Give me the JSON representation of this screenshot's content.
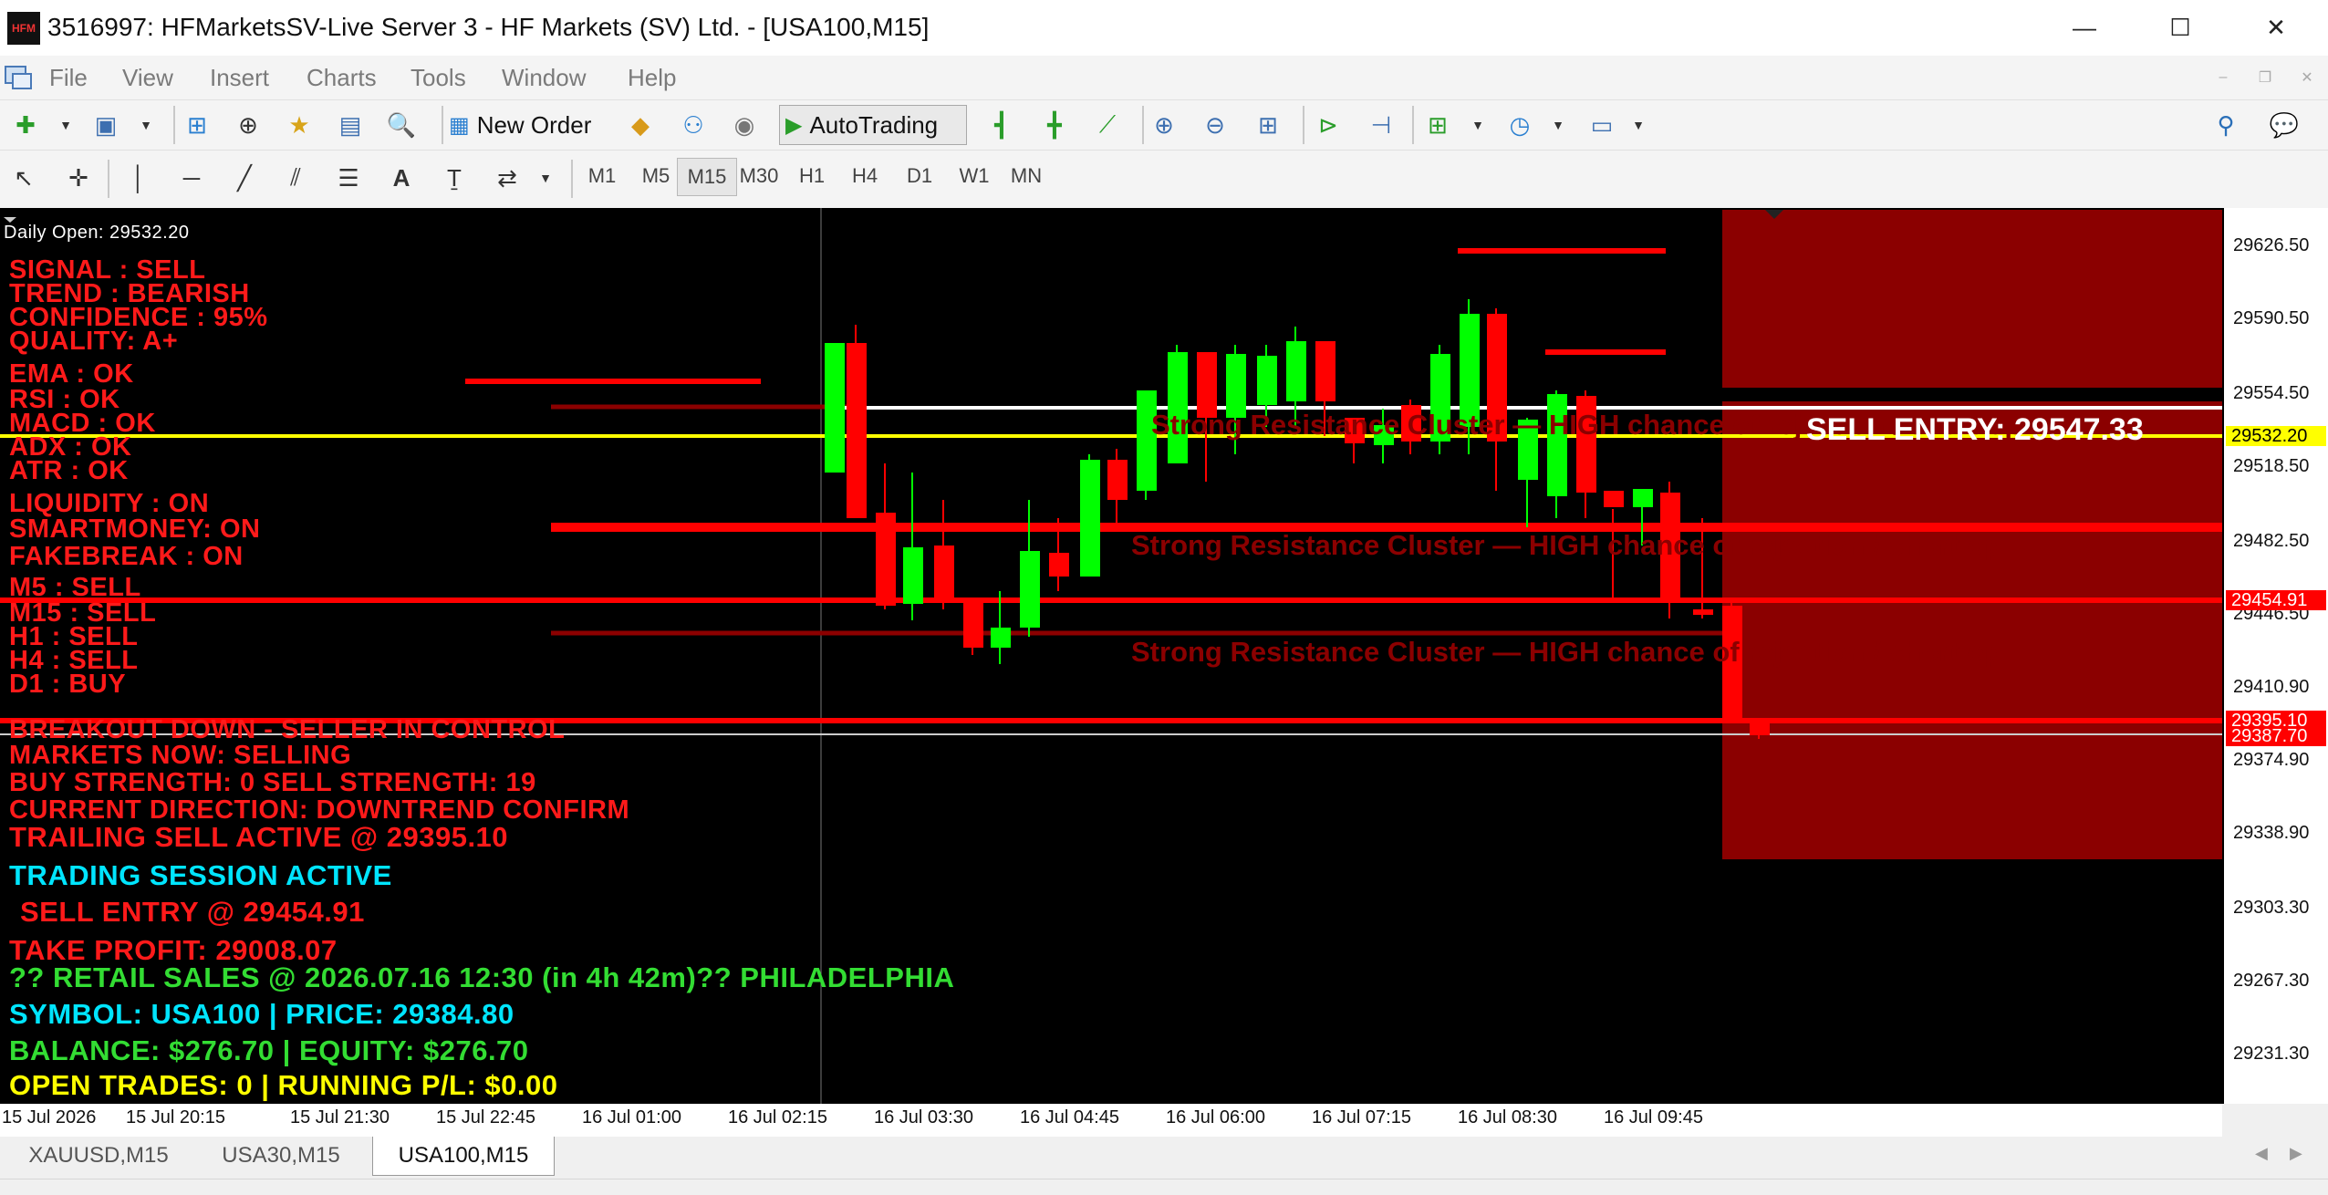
{
  "window": {
    "logo_text": "HFM",
    "title": "3516997: HFMarketsSV-Live Server 3 - HF Markets (SV) Ltd. - [USA100,M15]",
    "minimize": "—",
    "maximize": "☐",
    "close": "✕"
  },
  "menu": [
    "File",
    "View",
    "Insert",
    "Charts",
    "Tools",
    "Window",
    "Help"
  ],
  "toolbar": {
    "new_order": "New Order",
    "autotrading": "AutoTrading",
    "timeframes": [
      "M1",
      "M5",
      "M15",
      "M30",
      "H1",
      "H4",
      "D1",
      "W1",
      "MN"
    ],
    "active_timeframe": "M15"
  },
  "chart": {
    "daily_open": "Daily Open: 29532.20",
    "panel": {
      "signal": "SIGNAL : SELL",
      "trend": "TREND  : BEARISH",
      "confidence": "CONFIDENCE  : 95%",
      "quality": "QUALITY: A+",
      "ema": "EMA    : OK",
      "rsi": "RSI    : OK",
      "macd": "MACD   : OK",
      "adx": "ADX    : OK",
      "atr": "ATR    : OK",
      "liquidity": "LIQUIDITY : ON",
      "smartmoney": "SMARTMONEY: ON",
      "fakebreak": "FAKEBREAK : ON",
      "m5": "M5   : SELL",
      "m15": "M15 : SELL",
      "h1": "H1   : SELL",
      "h4": "H4   : SELL",
      "d1": "D1   : BUY",
      "breakout": "BREAKOUT DOWN - SELLER IN CONTROL",
      "markets_now": "MARKETS NOW: SELLING",
      "strength": "BUY STRENGTH: 0   SELL STRENGTH: 19",
      "direction": "CURRENT DIRECTION: DOWNTREND CONFIRM",
      "trailing": "TRAILING SELL ACTIVE @ 29395.10",
      "session": "TRADING SESSION ACTIVE",
      "sell_entry": "SELL ENTRY @ 29454.91",
      "take_profit": "TAKE PROFIT: 29008.07",
      "news": "?? RETAIL SALES @ 2026.07.16 12:30 (in 4h 42m)?? PHILADELPHIA",
      "symbol_price": "SYMBOL: USA100 | PRICE: 29384.80",
      "balance": "BALANCE: $276.70 | EQUITY: $276.70",
      "open_trades": "OPEN TRADES: 0 | RUNNING P/L: $0.00"
    },
    "sell_entry_label": "SELL ENTRY: 29547.33",
    "resistance_text": "Strong Resistance Cluster — HIGH chance of rejection / short op",
    "colors": {
      "bull": "#00ff00",
      "bear": "#ff0000",
      "panel_red": "#ff1a1a",
      "cyan": "#00e5ff",
      "green": "#33dd33",
      "yellow": "#ffff00",
      "zone": "#8b0000"
    },
    "price_axis": [
      "29626.50",
      "29590.50",
      "29554.50",
      "29518.50",
      "29482.50",
      "29446.50",
      "29410.90",
      "29374.90",
      "29338.90",
      "29303.30",
      "29267.30",
      "29231.30"
    ],
    "price_tags": {
      "daily_open": "29532.20",
      "entry": "29454.91",
      "trailing": "29395.10",
      "current": "29387.70"
    },
    "time_axis": [
      "15 Jul 2026",
      "15 Jul 20:15",
      "15 Jul 21:30",
      "15 Jul 22:45",
      "16 Jul 01:00",
      "16 Jul 02:15",
      "16 Jul 03:30",
      "16 Jul 04:45",
      "16 Jul 06:00",
      "16 Jul 07:15",
      "16 Jul 08:30",
      "16 Jul 09:45"
    ]
  },
  "tabs": [
    "XAUUSD,M15",
    "USA30,M15",
    "USA100,M15"
  ],
  "active_tab": "USA100,M15"
}
